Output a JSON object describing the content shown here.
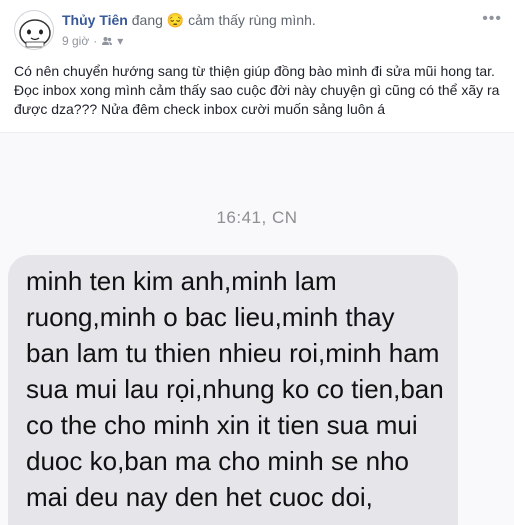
{
  "post": {
    "author": "Thủy Tiên",
    "activity_prefix": "đang",
    "feeling_emoji": "😔",
    "feeling_text": "cảm thấy rùng mình.",
    "time": "9 giờ",
    "more_label": "•••",
    "text_lines": [
      "Có nên chuyển hướng sang từ thiện giúp đồng bào mình đi sửa mũi hong tar.",
      "Đọc inbox xong mình cảm thấy sao cuộc đời này chuyện gì cũng có thể xãy ra",
      "được dza??? Nửa đêm check inbox cười muốn sảng luôn á"
    ]
  },
  "screenshot": {
    "timestamp": "16:41, CN",
    "message_lines": [
      "minh ten kim anh,minh lam",
      "ruong,minh o bac lieu,minh thay",
      "ban lam tu thien nhieu roi,minh ham",
      "sua mui lau rọi,nhung ko co tien,ban",
      "co the cho minh xin it tien sua mui",
      "duoc ko,ban ma cho minh se nho",
      "mai deu nay den het cuoc doi,"
    ]
  }
}
